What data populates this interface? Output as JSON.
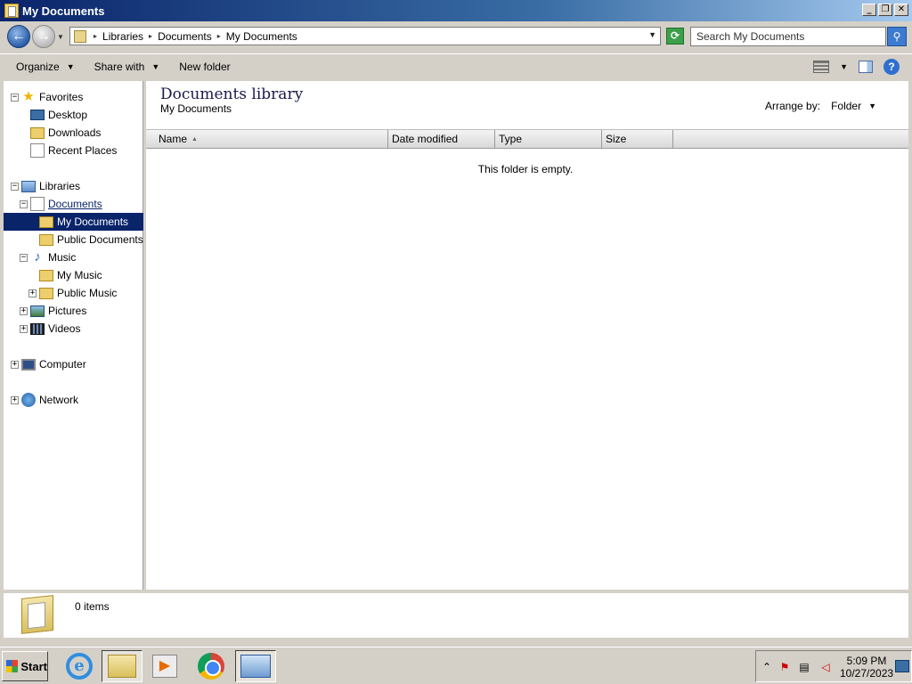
{
  "window": {
    "title": "My Documents"
  },
  "address": {
    "crumbs": [
      "Libraries",
      "Documents",
      "My Documents"
    ],
    "search_placeholder": "Search My Documents"
  },
  "toolbar": {
    "organize": "Organize",
    "share_with": "Share with",
    "new_folder": "New folder"
  },
  "nav": {
    "favorites": "Favorites",
    "desktop": "Desktop",
    "downloads": "Downloads",
    "recent_places": "Recent Places",
    "libraries": "Libraries",
    "documents": "Documents",
    "my_documents": "My Documents",
    "public_documents": "Public Documents",
    "music": "Music",
    "my_music": "My Music",
    "public_music": "Public Music",
    "pictures": "Pictures",
    "videos": "Videos",
    "computer": "Computer",
    "network": "Network"
  },
  "content": {
    "library_title": "Documents library",
    "library_subtitle": "My Documents",
    "arrange_label": "Arrange by:",
    "arrange_value": "Folder",
    "columns": [
      "Name",
      "Date modified",
      "Type",
      "Size"
    ],
    "empty_message": "This folder is empty."
  },
  "details": {
    "item_count": "0 items"
  },
  "taskbar": {
    "start": "Start",
    "time": "5:09 PM",
    "date": "10/27/2023"
  }
}
